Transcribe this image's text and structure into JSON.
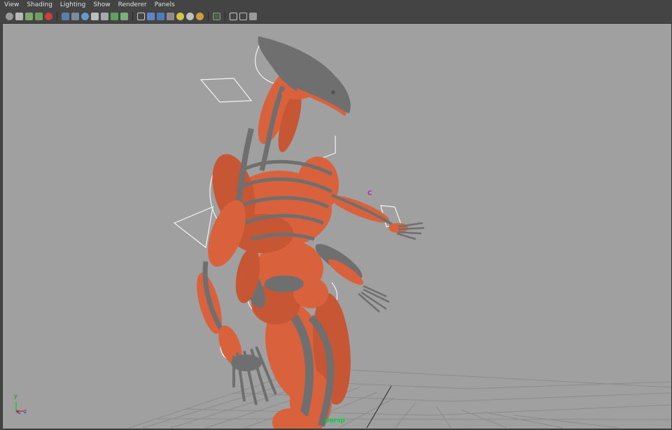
{
  "menubar": {
    "items": [
      "View",
      "Shading",
      "Lighting",
      "Show",
      "Renderer",
      "Panels"
    ]
  },
  "toolbar": {
    "icons": [
      "camera-select-icon",
      "camera-attr-icon",
      "bookmark-icon",
      "image-plane-icon",
      "isolate-icon",
      "grid-icon",
      "film-gate-icon",
      "resolution-gate-icon",
      "safe-action-icon",
      "field-chart-icon",
      "xray-icon",
      "textured-icon",
      "wireframe-icon",
      "smooth-shade-icon",
      "bounding-box-icon",
      "use-lights-icon",
      "default-light-icon",
      "shadows-icon",
      "high-quality-icon",
      "select-highlight-icon",
      "cube-icon",
      "layout-icon",
      "graph-icon"
    ]
  },
  "viewport": {
    "camera_label": "persp",
    "manipulator_label": "C",
    "axis": {
      "x": "x",
      "y": "y",
      "z": "z"
    }
  },
  "colors": {
    "muscle": "#d9623d",
    "bone": "#6f6f6f",
    "background": "#a0a0a0",
    "grid": "#8a8a8a",
    "camera_label": "#00d23c"
  }
}
